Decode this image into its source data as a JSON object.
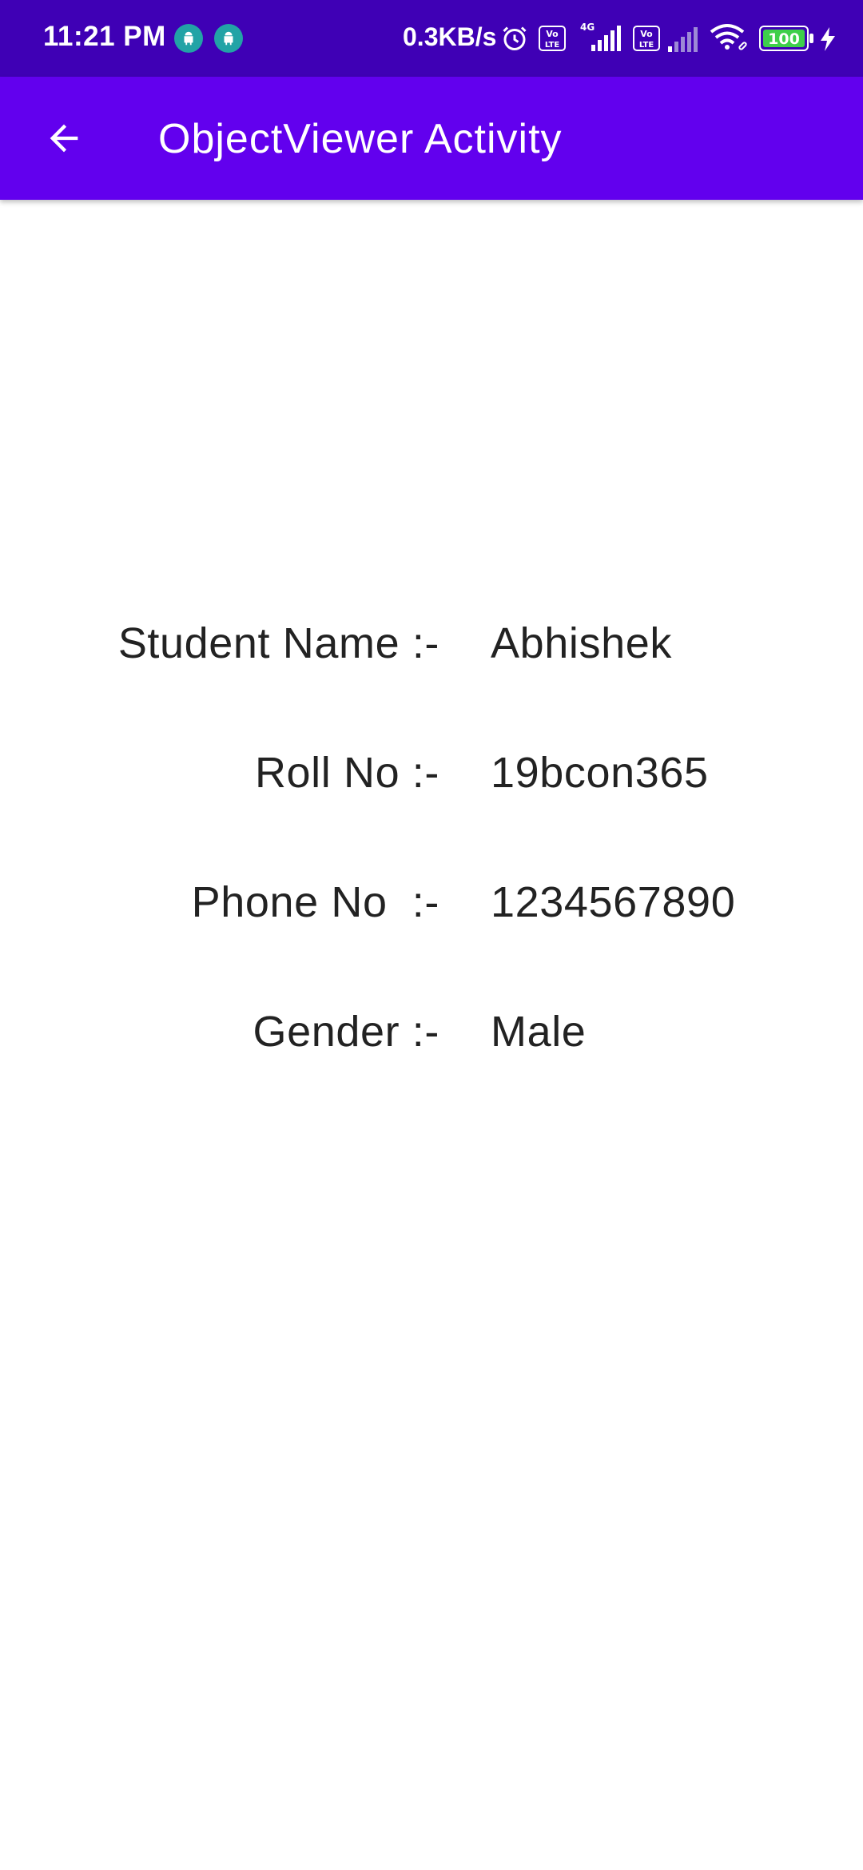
{
  "status_bar": {
    "time": "11:21 PM",
    "net_speed": "0.3KB/s",
    "battery_level": "100",
    "icons": [
      "android-icon",
      "android-icon",
      "alarm-icon",
      "volte-icon",
      "signal-4g-icon",
      "volte-icon",
      "signal-icon",
      "wifi-icon",
      "battery-icon",
      "charging-icon"
    ]
  },
  "app_bar": {
    "title": "ObjectViewer Activity",
    "back_icon": "arrow-back-icon",
    "color": "#6200ee"
  },
  "status_bar_color": "#3f00b5",
  "details": [
    {
      "label": "Student Name :-",
      "value": "Abhishek"
    },
    {
      "label": "Roll No :-",
      "value": "19bcon365"
    },
    {
      "label": "Phone No  :-",
      "value": "1234567890"
    },
    {
      "label": "Gender :-",
      "value": "Male"
    }
  ]
}
